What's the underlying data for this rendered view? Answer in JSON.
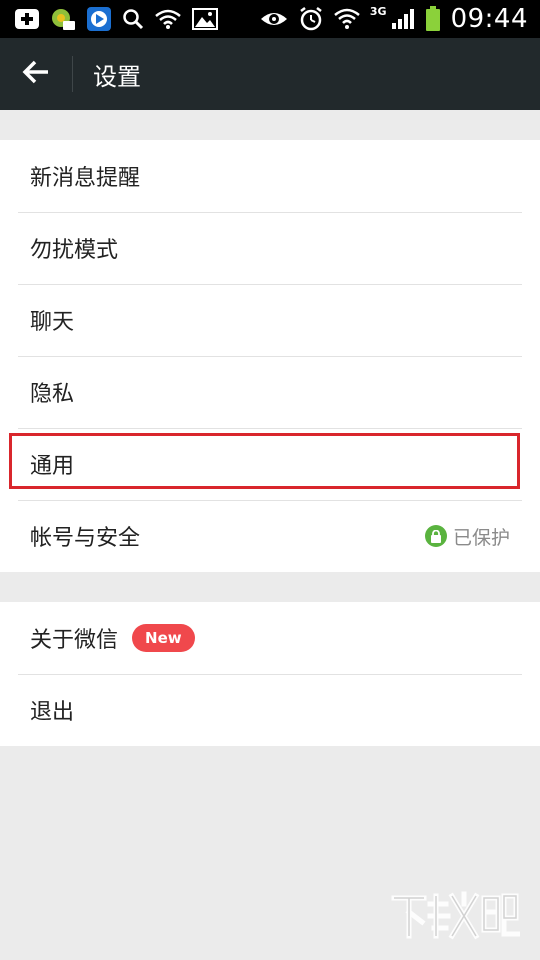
{
  "status_bar": {
    "time": "09:44",
    "network": "3G",
    "icons": [
      "add-icon",
      "game-icon",
      "video-player-icon",
      "search-icon",
      "wifi-icon",
      "image-icon",
      "eye-icon",
      "alarm-icon",
      "wifi-signal-icon",
      "cell-signal-icon",
      "battery-icon"
    ]
  },
  "header": {
    "title": "设置",
    "back_icon": "arrow-left-icon"
  },
  "group1": {
    "items": [
      {
        "label": "新消息提醒"
      },
      {
        "label": "勿扰模式"
      },
      {
        "label": "聊天"
      },
      {
        "label": "隐私"
      },
      {
        "label": "通用"
      },
      {
        "label": "帐号与安全",
        "status": "已保护",
        "status_icon": "lock-icon"
      }
    ]
  },
  "group2": {
    "items": [
      {
        "label": "关于微信",
        "badge": "New"
      },
      {
        "label": "退出"
      }
    ]
  },
  "colors": {
    "titlebar": "#22292c",
    "highlight": "#d9262c",
    "badge": "#f0484c",
    "lock": "#5ab33f"
  }
}
